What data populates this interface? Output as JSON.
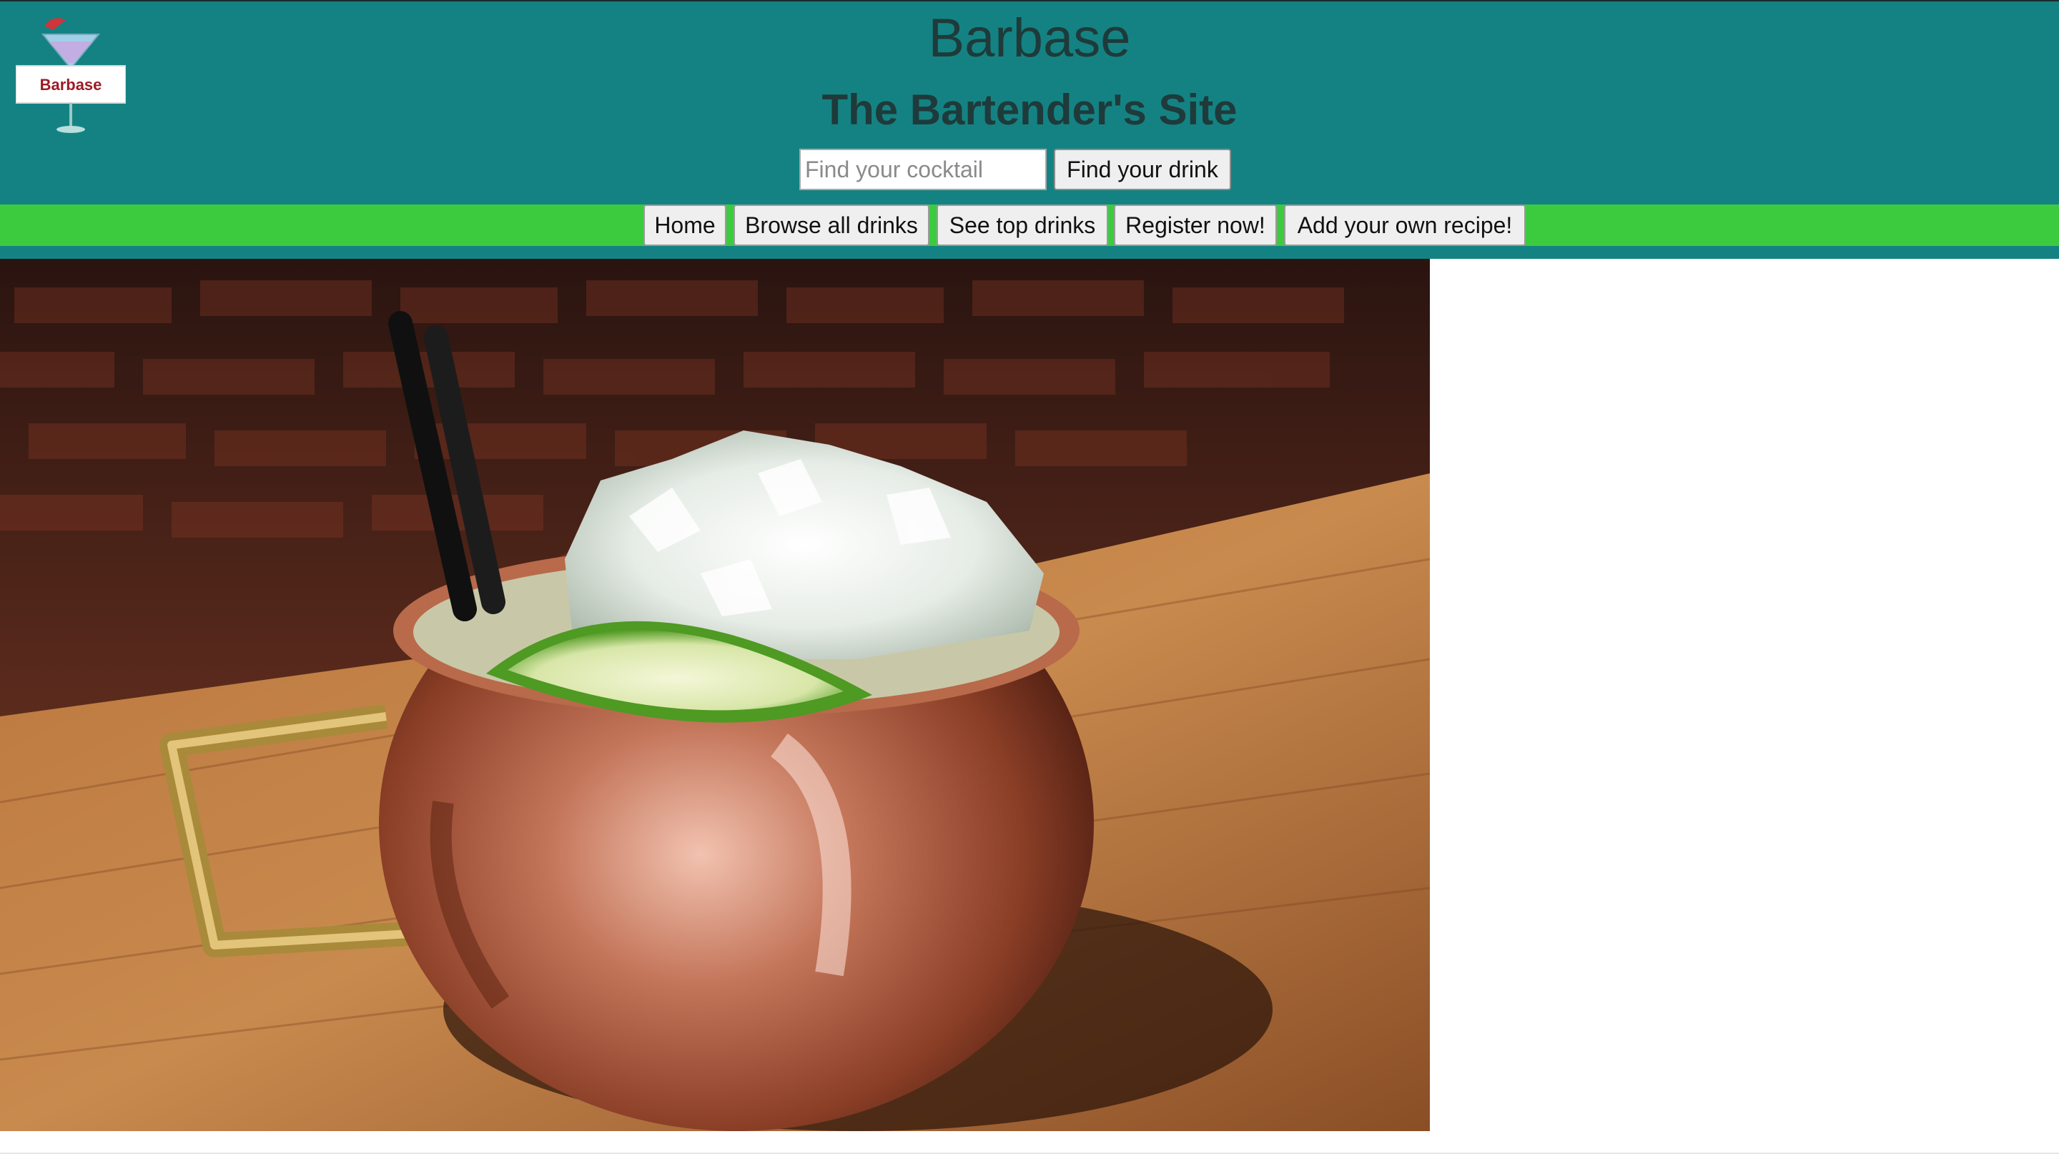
{
  "header": {
    "logo_text": "Barbase",
    "title": "Barbase",
    "subtitle": "The Bartender's Site"
  },
  "search": {
    "placeholder": "Find your cocktail",
    "value": "",
    "button_label": "Find your drink"
  },
  "nav": {
    "items": [
      {
        "label": "Home"
      },
      {
        "label": "Browse all drinks"
      },
      {
        "label": "See top drinks"
      },
      {
        "label": "Register now!"
      },
      {
        "label": "Add your own recipe!"
      }
    ]
  },
  "hero": {
    "icon": "copper-mug-cocktail-photo"
  },
  "colors": {
    "header_bg": "#148282",
    "nav_bg": "#3ccb3f",
    "title_text": "#1f3a3a"
  }
}
